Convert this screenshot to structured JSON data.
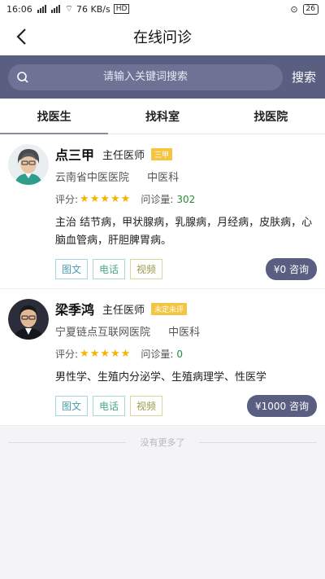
{
  "status_bar": {
    "time": "16:06",
    "network_speed": "76 KB/s",
    "hd_label": "HD",
    "battery": "26"
  },
  "nav": {
    "title": "在线问诊"
  },
  "search": {
    "placeholder": "请输入关键词搜索",
    "button_label": "搜索"
  },
  "tabs": [
    {
      "label": "找医生",
      "active": true
    },
    {
      "label": "找科室",
      "active": false
    },
    {
      "label": "找医院",
      "active": false
    }
  ],
  "doctors": [
    {
      "name": "点三甲",
      "title": "主任医师",
      "badge": "三甲",
      "hospital": "云南省中医医院",
      "department": "中医科",
      "rating_label": "评分:",
      "stars": 5,
      "visit_label": "问诊量:",
      "visit_count": "302",
      "description": "主治 结节病，甲状腺病，乳腺病，月经病，皮肤病，心脑血管病，肝胆脾胃病。",
      "services": [
        "图文",
        "电话",
        "视频"
      ],
      "consult_label": "¥0 咨询"
    },
    {
      "name": "梁季鸿",
      "title": "主任医师",
      "badge": "未定未评",
      "hospital": "宁夏链点互联网医院",
      "department": "中医科",
      "rating_label": "评分:",
      "stars": 5,
      "visit_label": "问诊量:",
      "visit_count": "0",
      "description": "男性学、生殖内分泌学、生殖病理学、性医学",
      "services": [
        "图文",
        "电话",
        "视频"
      ],
      "consult_label": "¥1000 咨询"
    }
  ],
  "footer": {
    "no_more": "没有更多了"
  },
  "colors": {
    "accent": "#5a5f82",
    "star": "#f4b400",
    "badge": "#f5c542",
    "visit_count": "#2a8a3a"
  }
}
